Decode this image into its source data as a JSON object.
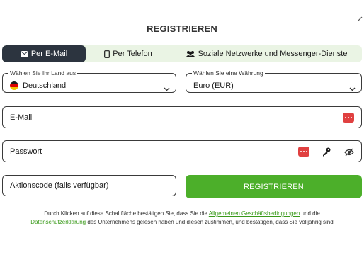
{
  "dialog": {
    "title": "REGISTRIEREN"
  },
  "tabs": [
    {
      "label": "Per E-Mail",
      "icon": "envelope-icon",
      "active": true
    },
    {
      "label": "Per Telefon",
      "icon": "phone-icon",
      "active": false
    },
    {
      "label": "Soziale Netzwerke und Messenger-Dienste",
      "icon": "users-icon",
      "active": false
    }
  ],
  "country": {
    "legend": "Wählen Sie Ihr Land aus",
    "value": "Deutschland",
    "flag": "germany-flag-icon"
  },
  "currency": {
    "legend": "Wählen Sie eine Währung",
    "value": "Euro (EUR)"
  },
  "email": {
    "placeholder": "E-Mail"
  },
  "password": {
    "placeholder": "Passwort"
  },
  "promo": {
    "placeholder": "Aktionscode (falls verfügbar)"
  },
  "submit": {
    "label": "REGISTRIEREN"
  },
  "legal": {
    "part1": "Durch Klicken auf diese Schaltfläche bestätigen Sie, dass Sie die ",
    "link1": "Allgemeinen Geschäftsbedingungen",
    "part2": " und die ",
    "link2": "Datenschutzerklärung",
    "part3": " des Unternehmens gelesen haben und diesen zustimmen, und bestätigen, dass Sie volljährig sind"
  },
  "colors": {
    "accent_green": "#4caf2a",
    "tab_active_bg": "#2c343f",
    "tab_bar_bg": "#eaf4e4",
    "password_manager_red": "#e04040",
    "link_green": "#3a9a1a"
  }
}
